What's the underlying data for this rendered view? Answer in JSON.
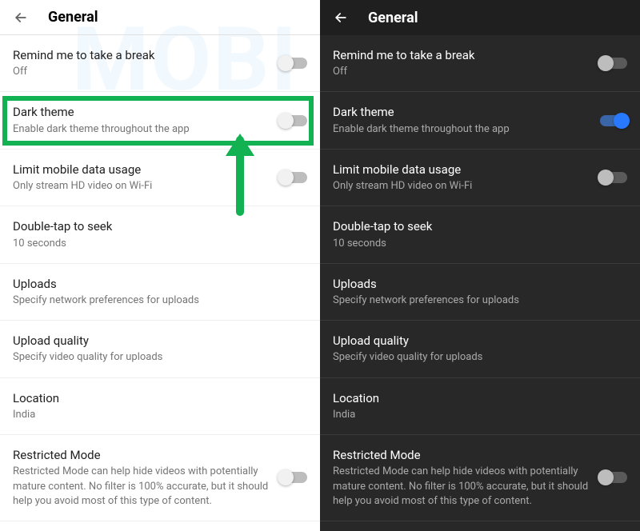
{
  "header": {
    "title": "General"
  },
  "items": {
    "remind": {
      "title": "Remind me to take a break",
      "sub": "Off"
    },
    "darkTheme": {
      "title": "Dark theme",
      "sub": "Enable dark theme throughout the app"
    },
    "limitData": {
      "title": "Limit mobile data usage",
      "sub": "Only stream HD video on Wi-Fi"
    },
    "doubleTap": {
      "title": "Double-tap to seek",
      "sub": "10 seconds"
    },
    "uploads": {
      "title": "Uploads",
      "sub": "Specify network preferences for uploads"
    },
    "uploadQuality": {
      "title": "Upload quality",
      "sub": "Specify video quality for uploads"
    },
    "location": {
      "title": "Location",
      "sub": "India"
    },
    "restricted": {
      "title": "Restricted Mode",
      "sub": "Restricted Mode can help hide videos with potentially mature content. No filter is 100% accurate, but it should help you avoid most of this type of content."
    }
  },
  "annotation": {
    "highlightColor": "#12b253",
    "arrowColor": "#12b253"
  }
}
